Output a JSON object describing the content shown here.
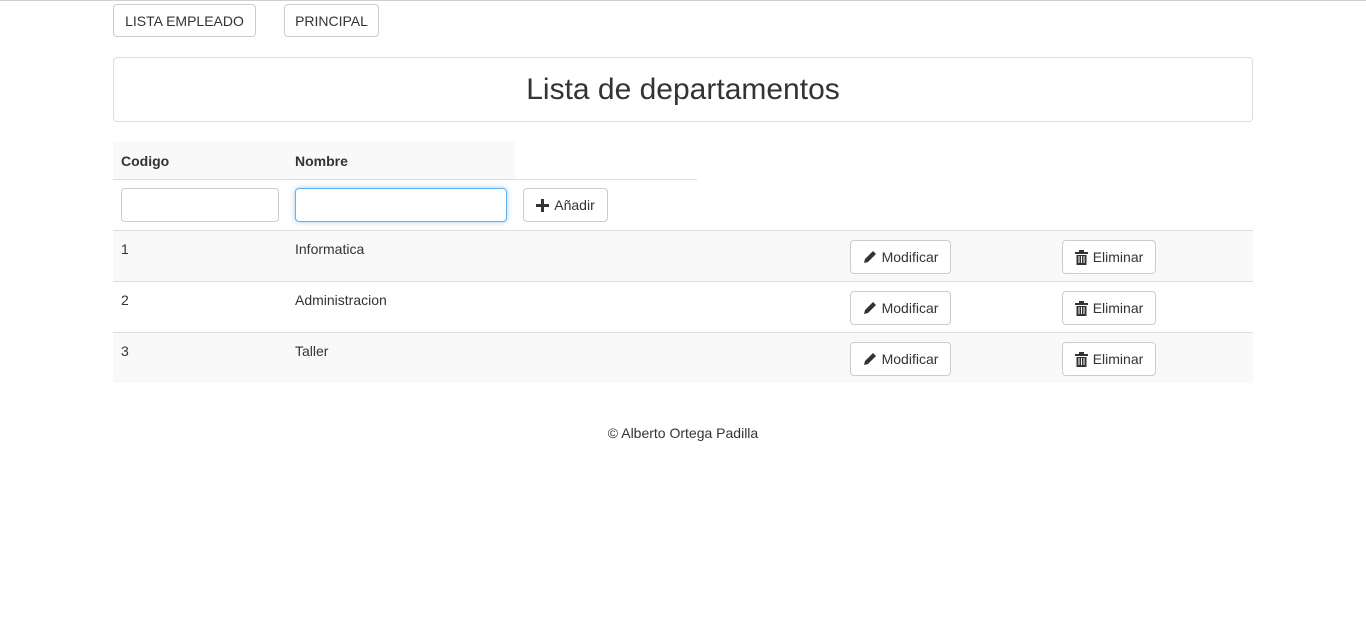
{
  "nav": {
    "lista_empleado_label": "LISTA EMPLEADO",
    "principal_label": "PRINCIPAL"
  },
  "page_title": "Lista de departamentos",
  "table": {
    "headers": {
      "codigo": "Codigo",
      "nombre": "Nombre"
    },
    "form": {
      "codigo_value": "",
      "nombre_value": "",
      "add_label": "Añadir"
    },
    "rows": [
      {
        "codigo": "1",
        "nombre": "Informatica",
        "modify_label": "Modificar",
        "delete_label": "Eliminar"
      },
      {
        "codigo": "2",
        "nombre": "Administracion",
        "modify_label": "Modificar",
        "delete_label": "Eliminar"
      },
      {
        "codigo": "3",
        "nombre": "Taller",
        "modify_label": "Modificar",
        "delete_label": "Eliminar"
      }
    ]
  },
  "footer": "© Alberto Ortega Padilla",
  "icons": {
    "add": "plus-icon",
    "modify": "pencil-icon",
    "delete": "trash-icon"
  },
  "colors": {
    "border": "#cccccc",
    "focus": "#66afe9",
    "stripe": "#f9f9f9",
    "text": "#333333"
  }
}
